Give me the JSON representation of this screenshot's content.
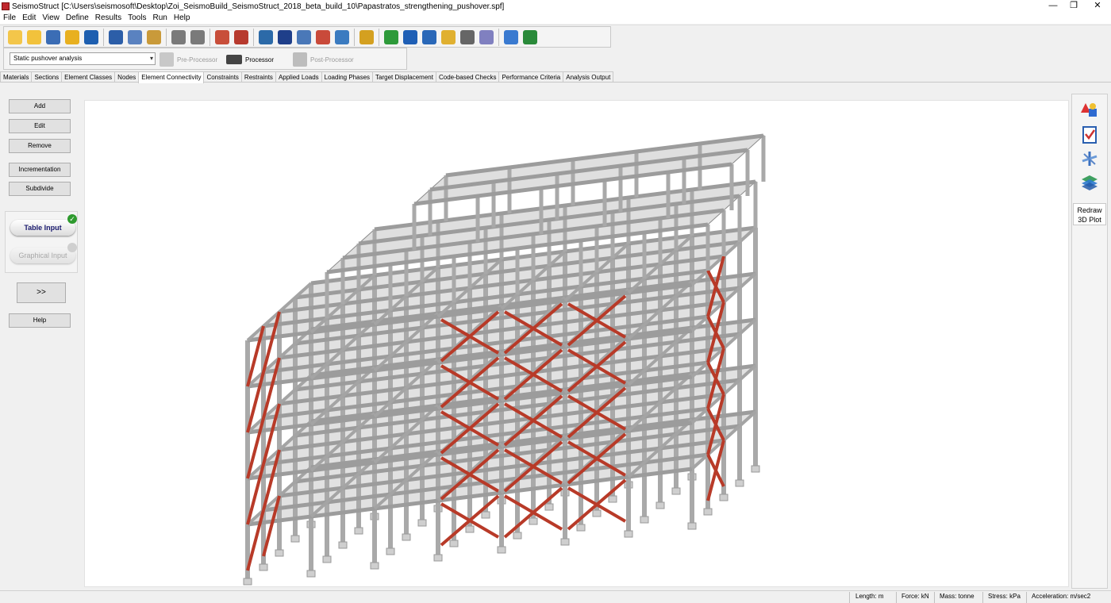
{
  "window": {
    "app_name": "SeismoStruct",
    "title": "SeismoStruct   [C:\\Users\\seismosoft\\Desktop\\Zoi_SeismoBuild_SeismoStruct_2018_beta_build_10\\Papastratos_strengthening_pushover.spf]",
    "minimize": "—",
    "restore": "❐",
    "close": "✕"
  },
  "menu": [
    "File",
    "Edit",
    "View",
    "Define",
    "Results",
    "Tools",
    "Run",
    "Help"
  ],
  "toolbar": {
    "icons": [
      {
        "name": "new-project-icon",
        "color": "#f3c64a"
      },
      {
        "name": "open-folder-icon",
        "color": "#f2c23c"
      },
      {
        "name": "building-wizard-icon",
        "color": "#3b6db5"
      },
      {
        "name": "magic-wand-icon",
        "color": "#e8b020"
      },
      {
        "name": "save-icon",
        "color": "#1e5fb0"
      },
      {
        "name": "print-icon",
        "color": "#2c5ea8"
      },
      {
        "name": "copy-icon",
        "color": "#5a82c0"
      },
      {
        "name": "paste-icon",
        "color": "#c99a3a"
      },
      {
        "name": "undo-icon",
        "color": "#7a7a7a"
      },
      {
        "name": "redo-icon",
        "color": "#7a7a7a"
      },
      {
        "name": "frame-editor-icon",
        "color": "#c84e3a"
      },
      {
        "name": "frame-run-icon",
        "color": "#b73a2e"
      },
      {
        "name": "connectivity-icon",
        "color": "#2c6aa8"
      },
      {
        "name": "units-icon",
        "color": "#1f3f8a"
      },
      {
        "name": "settings-gear-icon",
        "color": "#4a78b8"
      },
      {
        "name": "advanced-gear-icon",
        "color": "#c94a3a"
      },
      {
        "name": "calculator-icon",
        "color": "#3b7bc0"
      },
      {
        "name": "eraser-icon",
        "color": "#d4a020"
      },
      {
        "name": "help-icon",
        "color": "#2e9a3a"
      },
      {
        "name": "manual-book-icon",
        "color": "#1f5fb5"
      },
      {
        "name": "tutorial-book-icon",
        "color": "#2a68b8"
      },
      {
        "name": "search-docs-icon",
        "color": "#e0b030"
      },
      {
        "name": "video-icon",
        "color": "#666666"
      },
      {
        "name": "forum-chat-icon",
        "color": "#8080c0"
      },
      {
        "name": "edit-note-icon",
        "color": "#3a7ad0"
      },
      {
        "name": "globe-icon",
        "color": "#2a8a3a"
      }
    ]
  },
  "analysis_type": {
    "selected": "Static pushover analysis"
  },
  "modes": {
    "pre_processor": "Pre-Processor",
    "processor": "Processor",
    "post_processor": "Post-Processor"
  },
  "tabs": [
    {
      "label": "Materials",
      "active": false
    },
    {
      "label": "Sections",
      "active": false
    },
    {
      "label": "Element Classes",
      "active": false
    },
    {
      "label": "Nodes",
      "active": false
    },
    {
      "label": "Element Connectivity",
      "active": true
    },
    {
      "label": "Constraints",
      "active": false
    },
    {
      "label": "Restraints",
      "active": false
    },
    {
      "label": "Applied Loads",
      "active": false
    },
    {
      "label": "Loading Phases",
      "active": false
    },
    {
      "label": "Target Displacement",
      "active": false
    },
    {
      "label": "Code-based Checks",
      "active": false
    },
    {
      "label": "Performance Criteria",
      "active": false
    },
    {
      "label": "Analysis Output",
      "active": false
    }
  ],
  "left_panel": {
    "add": "Add",
    "edit": "Edit",
    "remove": "Remove",
    "incrementation": "Incrementation",
    "subdivide": "Subdivide",
    "table_input": "Table Input",
    "graphical_input": "Graphical Input",
    "expand": ">>",
    "help": "Help"
  },
  "right_panel": {
    "icons": [
      "shapes-icon",
      "checklist-icon",
      "axes-icon",
      "layers-icon"
    ],
    "redraw_line1": "Redraw",
    "redraw_line2": "3D Plot"
  },
  "status": {
    "length": "Length: m",
    "force": "Force: kN",
    "mass": "Mass: tonne",
    "stress": "Stress: kPa",
    "acceleration": "Acceleration: m/sec2"
  },
  "colors": {
    "steel_brace": "#b83a28",
    "concrete": "#a9a9a9",
    "slab": "#c9c9c9"
  }
}
